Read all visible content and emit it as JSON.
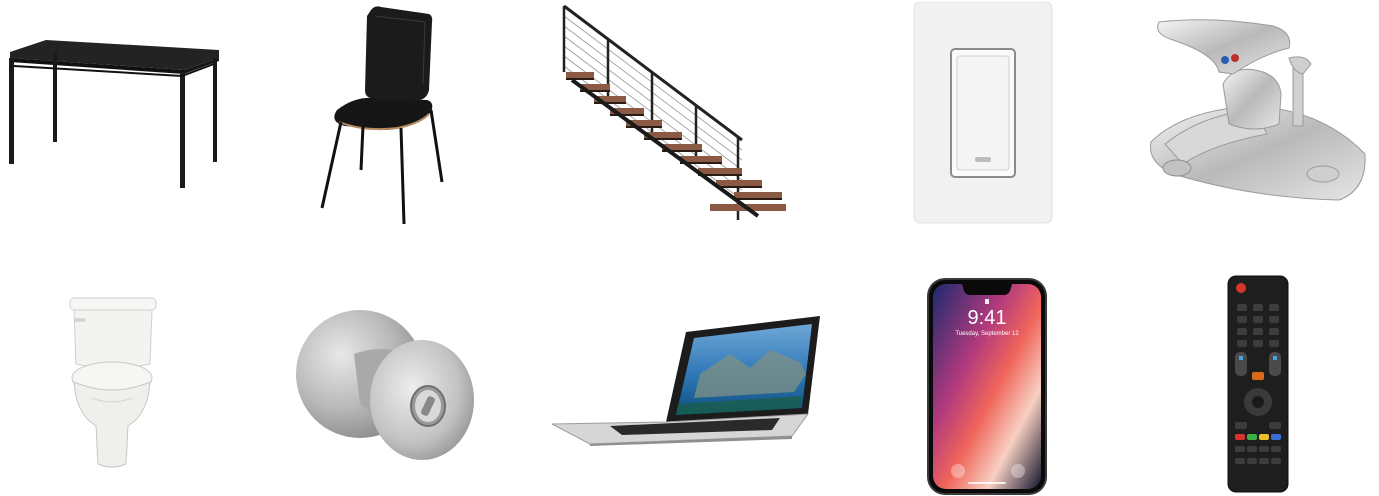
{
  "items": [
    {
      "id": "table",
      "name": "table"
    },
    {
      "id": "chair",
      "name": "chair"
    },
    {
      "id": "staircase",
      "name": "staircase"
    },
    {
      "id": "light-switch",
      "name": "light switch"
    },
    {
      "id": "faucet",
      "name": "faucet"
    },
    {
      "id": "toilet",
      "name": "toilet"
    },
    {
      "id": "door-knob",
      "name": "door knob"
    },
    {
      "id": "laptop",
      "name": "laptop"
    },
    {
      "id": "smartphone",
      "name": "smartphone"
    },
    {
      "id": "tv-remote",
      "name": "tv remote"
    }
  ],
  "phone_screen": {
    "time": "9:41",
    "date": "Tuesday, September 12"
  },
  "colors": {
    "background": "#ffffff",
    "black_furniture": "#1c1c1c",
    "stair_wood": "#8a5a44",
    "switch_plate": "#f1f1f1",
    "chrome": "#c9c9c9",
    "porcelain": "#f4f4f2",
    "laptop_silver": "#d6d6d6",
    "remote_red": "#d9342b"
  }
}
